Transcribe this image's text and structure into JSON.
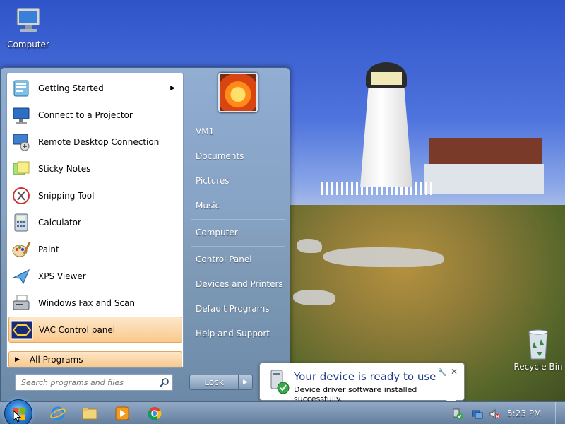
{
  "desktop": {
    "icons": [
      {
        "label": "Computer"
      },
      {
        "label": "Recycle Bin"
      }
    ]
  },
  "start_menu": {
    "programs": [
      {
        "label": "Getting Started",
        "icon": "getting-started-icon",
        "has_submenu": true
      },
      {
        "label": "Connect to a Projector",
        "icon": "projector-icon"
      },
      {
        "label": "Remote Desktop Connection",
        "icon": "remote-desktop-icon"
      },
      {
        "label": "Sticky Notes",
        "icon": "sticky-notes-icon"
      },
      {
        "label": "Snipping Tool",
        "icon": "snipping-tool-icon"
      },
      {
        "label": "Calculator",
        "icon": "calculator-icon"
      },
      {
        "label": "Paint",
        "icon": "paint-icon"
      },
      {
        "label": "XPS Viewer",
        "icon": "xps-viewer-icon"
      },
      {
        "label": "Windows Fax and Scan",
        "icon": "fax-scan-icon"
      },
      {
        "label": "VAC Control panel",
        "icon": "vac-control-icon",
        "highlighted": true
      }
    ],
    "all_programs_label": "All Programs",
    "search_placeholder": "Search programs and files",
    "right_items": [
      "VM1",
      "Documents",
      "Pictures",
      "Music",
      "Computer",
      "Control Panel",
      "Devices and Printers",
      "Default Programs",
      "Help and Support"
    ],
    "lock_label": "Lock"
  },
  "notification": {
    "title": "Your device is ready to use",
    "message": "Device driver software installed successfully."
  },
  "taskbar": {
    "pinned": [
      {
        "name": "internet-explorer-icon"
      },
      {
        "name": "file-explorer-icon"
      },
      {
        "name": "media-player-icon"
      },
      {
        "name": "chrome-icon"
      }
    ],
    "clock": "5:23 PM"
  },
  "colors": {
    "accent_highlight": "#f9c98d",
    "balloon_title": "#1e3b88",
    "taskbar": "#5f7a9b"
  }
}
